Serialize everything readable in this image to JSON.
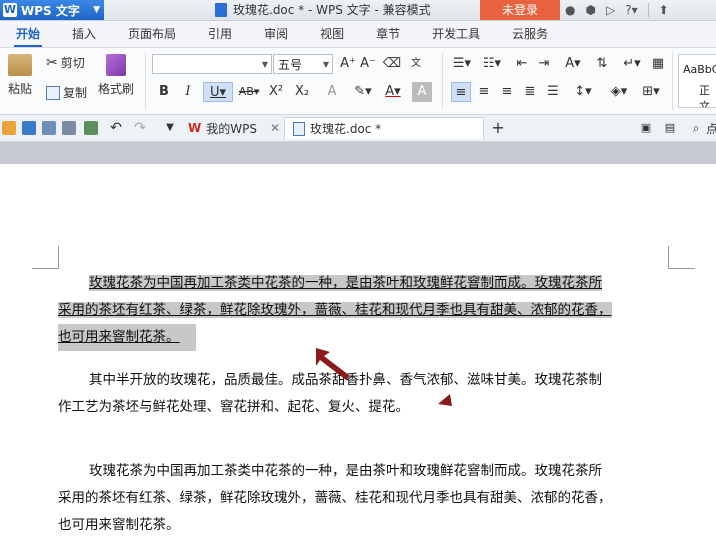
{
  "titlebar": {
    "app_name": "WPS 文字",
    "doc_title": "玫瑰花.doc * - WPS 文字 - 兼容模式",
    "login_label": "未登录",
    "help_label": "?"
  },
  "ribbon_tabs": [
    "开始",
    "插入",
    "页面布局",
    "引用",
    "审阅",
    "视图",
    "章节",
    "开发工具",
    "云服务"
  ],
  "ribbon": {
    "cut_label": "剪切",
    "copy_label": "复制",
    "paste_label": "粘贴",
    "format_painter_label": "格式刷",
    "font_name": "",
    "font_size": "五号",
    "styles_preview": "AaBbC",
    "styles_label": "正文"
  },
  "doc_tabs": [
    {
      "label": "我的WPS"
    },
    {
      "label": "玫瑰花.doc *"
    }
  ],
  "document": {
    "para1_lines": [
      "玫瑰花茶为中国再加工茶类中花茶的一种，是由茶叶和玫瑰鲜花窨制而成。玫瑰花茶所",
      "采用的茶坯有红茶、绿茶，鲜花除玫瑰外，蔷薇、桂花和现代月季也具有甜美、浓郁的花香，",
      "也可用来窨制花茶。"
    ],
    "para2_lines": [
      "其中半开放的玫瑰花，品质最佳。成品茶甜香扑鼻、香气浓郁、滋味甘美。玫瑰花茶制",
      "作工艺为茶坯与鲜花处理、窨花拼和、起花、复火、提花。"
    ],
    "para3_lines": [
      "玫瑰花茶为中国再加工茶类中花茶的一种，是由茶叶和玫瑰鲜花窨制而成。玫瑰花茶所",
      "采用的茶坯有红茶、绿茶，鲜花除玫瑰外，蔷薇、桂花和现代月季也具有甜美、浓郁的花香，",
      "也可用来窨制花茶。"
    ]
  },
  "colors": {
    "accent": "#1f64c6",
    "login": "#e8633d",
    "selection": "#c8c8c8",
    "arrow": "#8b1a1a"
  }
}
